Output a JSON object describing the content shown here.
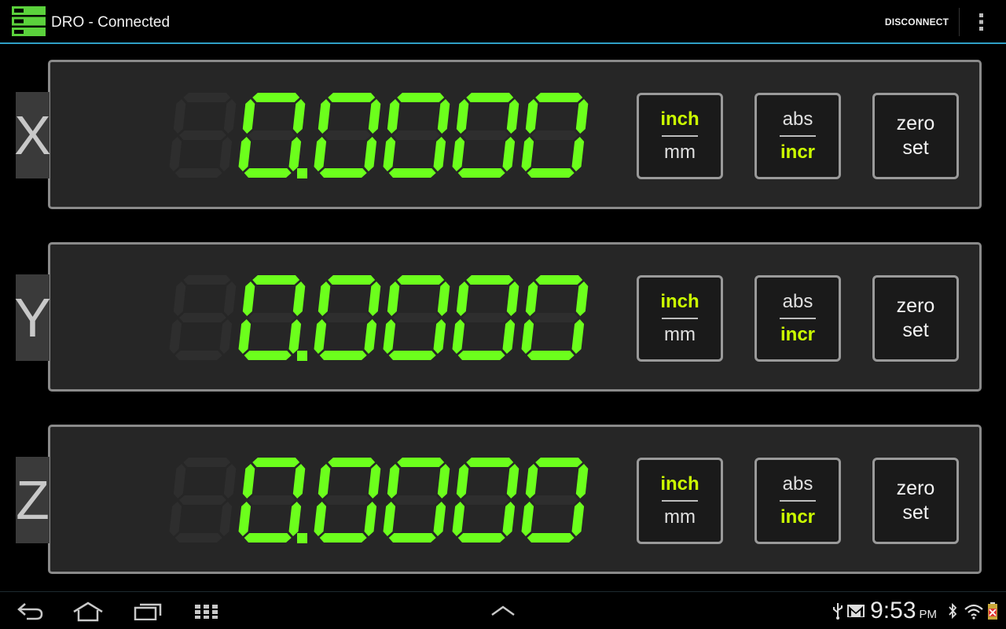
{
  "app": {
    "title": "DRO - Connected",
    "disconnect_label": "DISCONNECT",
    "accent_color": "#2f9fc6"
  },
  "display": {
    "segment_on_color": "#6cff1c",
    "segment_off_color": "#2e2e2e"
  },
  "axes": [
    {
      "label": "X",
      "reading": "0.0000",
      "unit_options": [
        "inch",
        "mm"
      ],
      "unit_selected": "inch",
      "mode_options": [
        "abs",
        "incr"
      ],
      "mode_selected": "incr",
      "zero_label_line1": "zero",
      "zero_label_line2": "set"
    },
    {
      "label": "Y",
      "reading": "0.0000",
      "unit_options": [
        "inch",
        "mm"
      ],
      "unit_selected": "inch",
      "mode_options": [
        "abs",
        "incr"
      ],
      "mode_selected": "incr",
      "zero_label_line1": "zero",
      "zero_label_line2": "set"
    },
    {
      "label": "Z",
      "reading": "0.0000",
      "unit_options": [
        "inch",
        "mm"
      ],
      "unit_selected": "inch",
      "mode_options": [
        "abs",
        "incr"
      ],
      "mode_selected": "incr",
      "zero_label_line1": "zero",
      "zero_label_line2": "set"
    }
  ],
  "statusbar": {
    "time": "9:53",
    "ampm": "PM",
    "icons": [
      "usb-icon",
      "gmail-icon",
      "bluetooth-icon",
      "wifi-icon",
      "battery-icon"
    ]
  },
  "navbar": {
    "icons": [
      "back-icon",
      "home-icon",
      "recent-apps-icon",
      "all-apps-icon",
      "menu-up-icon"
    ]
  }
}
